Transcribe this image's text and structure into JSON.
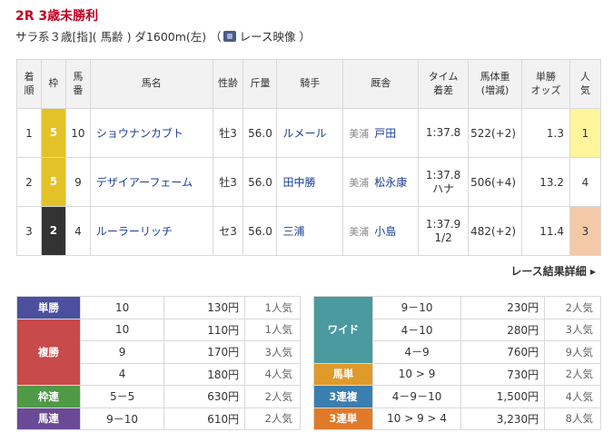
{
  "race": {
    "title": "2R 3歳未勝利",
    "conditions": "サラ系３歳[指]( 馬齢 ) ダ1600m(左) （",
    "video_label": "レース映像 ）"
  },
  "result_table": {
    "headers": [
      "着順",
      "枠",
      "馬番",
      "馬名",
      "性齢",
      "斤量",
      "騎手",
      "厩舎",
      "タイム着差",
      "馬体重(増減)",
      "単勝オッズ",
      "人気"
    ],
    "header_lines": {
      "rank": [
        "着",
        "順"
      ],
      "waku": [
        "枠"
      ],
      "num": [
        "馬",
        "番"
      ],
      "name": [
        "馬名"
      ],
      "sex": [
        "性齢"
      ],
      "weight": [
        "斤量"
      ],
      "jockey": [
        "騎手"
      ],
      "stable": [
        "厩舎"
      ],
      "time": [
        "タイム",
        "着差"
      ],
      "body": [
        "馬体重",
        "(増減)"
      ],
      "odds": [
        "単勝",
        "オッズ"
      ],
      "pop": [
        "人",
        "気"
      ]
    },
    "rows": [
      {
        "rank": "1",
        "waku": "5",
        "num": "10",
        "name": "ショウナンカブト",
        "sex": "牡3",
        "weight": "56.0",
        "jockey": "ルメール",
        "region": "美浦",
        "trainer": "戸田",
        "time": "1:37.8",
        "margin": "",
        "body": "522(+2)",
        "odds": "1.3",
        "pop": "1"
      },
      {
        "rank": "2",
        "waku": "5",
        "num": "9",
        "name": "デザイアーフェーム",
        "sex": "牡3",
        "weight": "56.0",
        "jockey": "田中勝",
        "region": "美浦",
        "trainer": "松永康",
        "time": "1:37.8",
        "margin": "ハナ",
        "body": "506(+4)",
        "odds": "13.2",
        "pop": "4"
      },
      {
        "rank": "3",
        "waku": "2",
        "num": "4",
        "name": "ルーラーリッチ",
        "sex": "セ3",
        "weight": "56.0",
        "jockey": "三浦",
        "region": "美浦",
        "trainer": "小島",
        "time": "1:37.9",
        "margin": "1/2",
        "body": "482(+2)",
        "odds": "11.4",
        "pop": "3"
      }
    ]
  },
  "detail_link": "レース結果詳細 ▸",
  "payouts_left": {
    "tansho": {
      "label": "単勝",
      "rows": [
        {
          "num": "10",
          "yen": "130円",
          "pop": "1人気"
        }
      ]
    },
    "fukusho": {
      "label": "複勝",
      "rows": [
        {
          "num": "10",
          "yen": "110円",
          "pop": "1人気"
        },
        {
          "num": "9",
          "yen": "170円",
          "pop": "3人気"
        },
        {
          "num": "4",
          "yen": "180円",
          "pop": "4人気"
        }
      ]
    },
    "wakuren": {
      "label": "枠連",
      "rows": [
        {
          "num": "5－5",
          "yen": "630円",
          "pop": "2人気"
        }
      ]
    },
    "umaren": {
      "label": "馬連",
      "rows": [
        {
          "num": "9－10",
          "yen": "610円",
          "pop": "2人気"
        }
      ]
    }
  },
  "payouts_right": {
    "wide": {
      "label": "ワイド",
      "rows": [
        {
          "num": "9－10",
          "yen": "230円",
          "pop": "2人気"
        },
        {
          "num": "4－10",
          "yen": "280円",
          "pop": "3人気"
        },
        {
          "num": "4－9",
          "yen": "760円",
          "pop": "9人気"
        }
      ]
    },
    "umatan": {
      "label": "馬単",
      "rows": [
        {
          "num": "10 > 9",
          "yen": "730円",
          "pop": "2人気"
        }
      ]
    },
    "sanrenpuku": {
      "label": "3連複",
      "rows": [
        {
          "num": "4－9－10",
          "yen": "1,500円",
          "pop": "4人気"
        }
      ]
    },
    "sanrentan": {
      "label": "3連単",
      "rows": [
        {
          "num": "10 > 9 > 4",
          "yen": "3,230円",
          "pop": "8人気"
        }
      ]
    }
  },
  "colors": {
    "title_red": "#c00020",
    "link_blue": "#1a3e96",
    "waku_5": "#e3c227",
    "waku_2": "#333333",
    "pop1_bg": "#fff59b",
    "pop3_bg": "#f3c9a8"
  }
}
